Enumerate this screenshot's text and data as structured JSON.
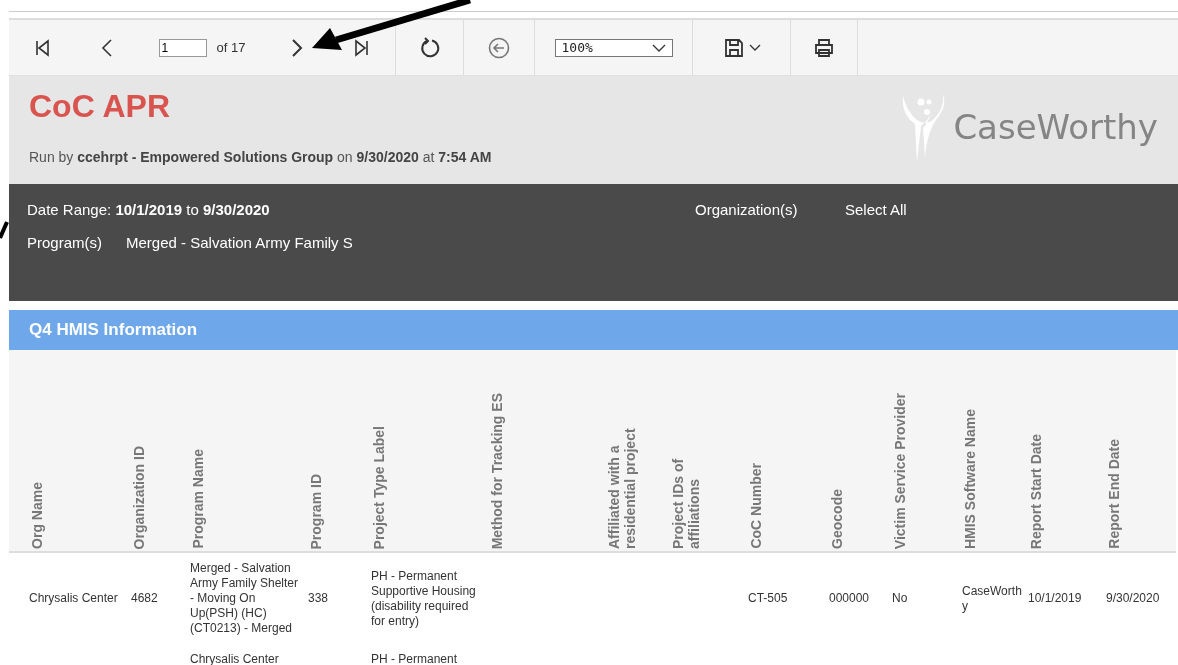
{
  "toolbar": {
    "page_value": "1",
    "page_count": "of 17",
    "zoom": "100%"
  },
  "header": {
    "title": "CoC APR",
    "run_by": "Run by **ccehrpt - Empowered Solutions Group** on **9/30/2020** at **7:54 AM**",
    "logo": "CaseWorthy"
  },
  "filters": {
    "date_range": "Date Range: **10/1/2019** to **9/30/2020**",
    "organizations_label": "Organization(s)",
    "organizations_value": "Select All",
    "programs_label": "Program(s)",
    "programs_value": "Merged - Salvation Army Family S"
  },
  "section": {
    "title": "Q4 HMIS Information"
  },
  "table": {
    "columns": [
      "Org Name",
      "Organization ID",
      "Program Name",
      "Program ID",
      "Project Type Label",
      "Method for Tracking ES",
      "Affiliated with a residential project",
      "Project IDs of affiliations",
      "CoC Number",
      "Geocode",
      "Victim Service Provider",
      "HMIS Software Name",
      "Report Start Date",
      "Report End Date"
    ],
    "rows": [
      {
        "cells": [
          "Chrysalis Center",
          "4682",
          "Merged - Salvation Army Family Shelter - Moving On Up(PSH) (HC)(CT0213) - Merged",
          "338",
          "PH - Permanent Supportive Housing (disability required for entry)",
          null,
          null,
          null,
          "CT-505",
          "000000",
          "No",
          "CaseWorthy",
          "10/1/2019",
          "9/30/2020"
        ]
      },
      {
        "cells": [
          null,
          null,
          "Chrysalis Center",
          null,
          "PH - Permanent",
          null,
          null,
          null,
          null,
          null,
          null,
          null,
          null,
          null
        ]
      }
    ]
  }
}
